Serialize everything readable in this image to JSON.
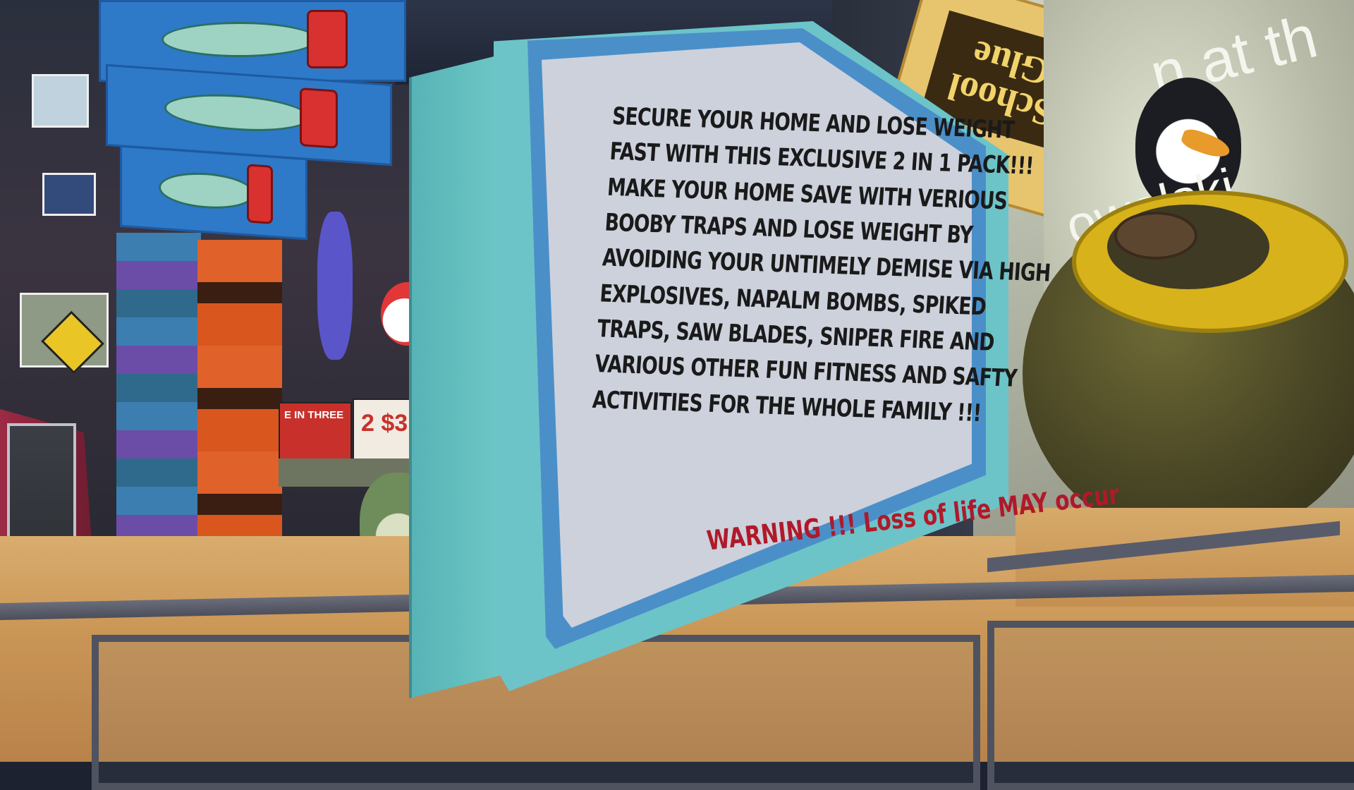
{
  "product_box": {
    "headline_lines": [
      "SECURE YOUR HOME AND LOSE WEIGHT",
      "FAST WITH THIS EXCLUSIVE 2 IN 1 PACK!!!",
      "MAKE YOUR HOME SAVE WITH VERIOUS",
      "BOOBY TRAPS AND LOSE WEIGHT BY",
      "AVOIDING YOUR UNTIMELY DEMISE VIA HIGH",
      "EXPLOSIVES, NAPALM BOMBS, SPIKED",
      "TRAPS, SAW BLADES, SNIPER FIRE AND",
      "VARIOUS OTHER FUN FITNESS AND SAFTY",
      "ACTIVITIES FOR THE WHOLE FAMILY !!!"
    ],
    "warning": "WARNING !!! Loss of life MAY occur",
    "colors": {
      "box": "#6cc4c9",
      "frame": "#4b8fc9",
      "label": "#ccd1dc",
      "warning": "#b0192a"
    }
  },
  "props": {
    "glue_label": "School Glue",
    "penguin_caption_1": "n at th",
    "penguin_caption_2": "owalski",
    "ad_three": "E IN THREE",
    "ad_2for3": "2 $3"
  },
  "icons": {
    "bomb": "bomb-icon",
    "penguin": "penguin-icon"
  }
}
